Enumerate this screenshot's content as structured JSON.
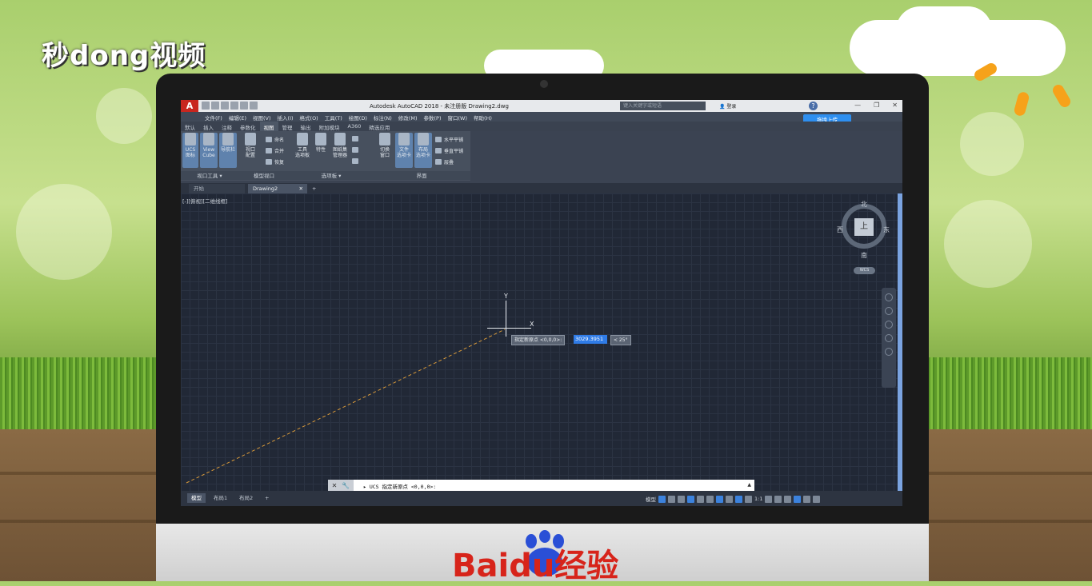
{
  "watermark_top": "秒dong视频",
  "watermark_bottom": "Baidu经验",
  "app": {
    "title": "Autodesk AutoCAD 2018 - 未注册版    Drawing2.dwg",
    "search_placeholder": "键入关键字或短语",
    "login_label": "登录",
    "upload_label": "拖拽上传"
  },
  "menu": [
    "文件(F)",
    "编辑(E)",
    "视图(V)",
    "插入(I)",
    "格式(O)",
    "工具(T)",
    "绘图(D)",
    "标注(N)",
    "修改(M)",
    "参数(P)",
    "窗口(W)",
    "帮助(H)"
  ],
  "ribbon_tabs": [
    "默认",
    "插入",
    "注释",
    "参数化",
    "视图",
    "管理",
    "输出",
    "附加模块",
    "A360",
    "精选应用"
  ],
  "ribbon_active_tab": "视图",
  "ribbon": {
    "ucs_icon": "UCS\n图标",
    "view_cube": "View\nCube",
    "nav_bar": "导航栏",
    "viewport_config": "视口\n配置",
    "named": "命名",
    "join": "合并",
    "restore": "恢复",
    "tool_palettes": "工具\n选项板",
    "properties": "特性",
    "sheet_set": "图纸集\n管理器",
    "switch_windows": "切换\n窗口",
    "file_tabs": "文件\n选项卡",
    "layout_tabs": "布局\n选项卡",
    "tile_horizontal": "水平平铺",
    "tile_vertical": "垂直平铺",
    "cascade": "层叠",
    "panels": [
      "视口工具 ▾",
      "模型视口",
      "选项板 ▾",
      "界面"
    ]
  },
  "doc_tabs": {
    "start": "开始",
    "drawing": "Drawing2"
  },
  "viewport": {
    "label": "[-][俯视][二维线框]",
    "viewcube": {
      "top": "上",
      "north": "北",
      "south": "南",
      "east": "东",
      "west": "西",
      "wcs": "WCS"
    },
    "cursor_y": "Y",
    "cursor_x": "X",
    "dynamic_prompt": "指定新原点 <0,0,0>:",
    "dynamic_input": "3029.3951",
    "dynamic_angle": "< 25°"
  },
  "command_line": "▸ UCS 指定新原点 <0,0,0>:",
  "layout_tabs": [
    "模型",
    "布局1",
    "布局2"
  ],
  "status": {
    "model": "模型",
    "scale": "1:1"
  }
}
